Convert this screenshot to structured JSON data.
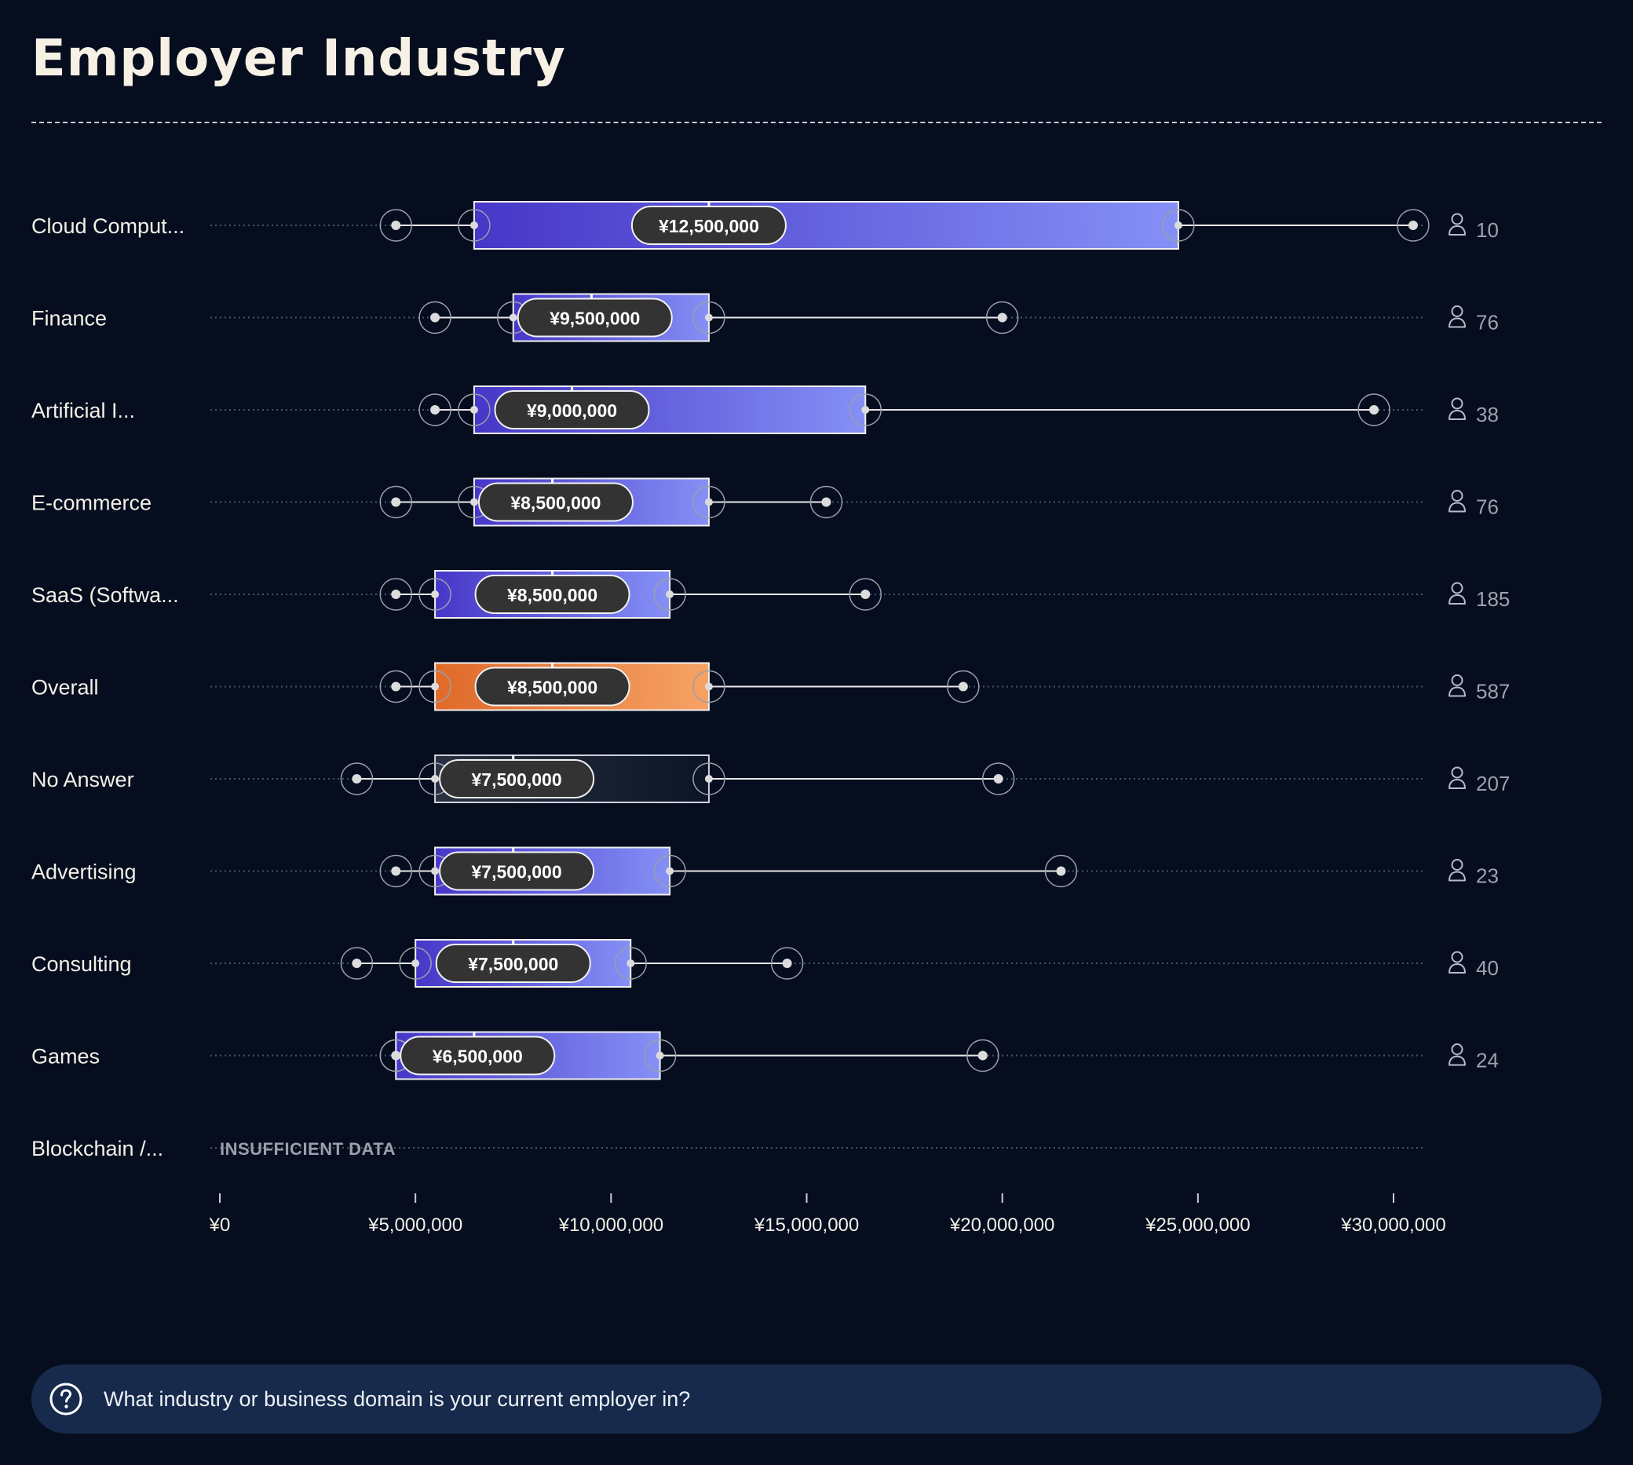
{
  "page": {
    "title": "Employer Industry",
    "question": "What industry or business domain is your current employer in?"
  },
  "icons": {
    "respondents": "person-icon",
    "question": "question-circle-icon"
  },
  "colors": {
    "background": "#050d1f",
    "box_default_start": "#4737c8",
    "box_default_end": "#8590f5",
    "box_overall_start": "#e06a2a",
    "box_overall_end": "#f6a265",
    "box_no_answer_start": "#2a3142",
    "box_no_answer_end": "#0b1526",
    "median_pill": "#333333",
    "footer_bg": "#172a4b"
  },
  "chart_data": {
    "type": "boxplot",
    "orientation": "horizontal",
    "title": "Employer Industry",
    "xlim": [
      0,
      30000000
    ],
    "x_ticks": [
      0,
      5000000,
      10000000,
      15000000,
      20000000,
      25000000,
      30000000
    ],
    "x_tick_labels": [
      "¥0",
      "¥5,000,000",
      "¥10,000,000",
      "¥15,000,000",
      "¥20,000,000",
      "¥25,000,000",
      "¥30,000,000"
    ],
    "insufficient_label": "INSUFFICIENT DATA",
    "categories": [
      {
        "label": "Cloud Comput...",
        "min": 4500000,
        "q1": 6500000,
        "median": 12500000,
        "q3": 24500000,
        "max": 30500000,
        "median_label": "¥12,500,000",
        "count": "10",
        "style": "default"
      },
      {
        "label": "Finance",
        "min": 5500000,
        "q1": 7500000,
        "median": 9500000,
        "q3": 12500000,
        "max": 20000000,
        "median_label": "¥9,500,000",
        "count": "76",
        "style": "default"
      },
      {
        "label": "Artificial I...",
        "min": 5500000,
        "q1": 6500000,
        "median": 9000000,
        "q3": 16500000,
        "max": 29500000,
        "median_label": "¥9,000,000",
        "count": "38",
        "style": "default"
      },
      {
        "label": "E-commerce",
        "min": 4500000,
        "q1": 6500000,
        "median": 8500000,
        "q3": 12500000,
        "max": 15500000,
        "median_label": "¥8,500,000",
        "count": "76",
        "style": "default"
      },
      {
        "label": "SaaS (Softwa...",
        "min": 4500000,
        "q1": 5500000,
        "median": 8500000,
        "q3": 11500000,
        "max": 16500000,
        "median_label": "¥8,500,000",
        "count": "185",
        "style": "default"
      },
      {
        "label": "Overall",
        "min": 4500000,
        "q1": 5500000,
        "median": 8500000,
        "q3": 12500000,
        "max": 19000000,
        "median_label": "¥8,500,000",
        "count": "587",
        "style": "overall"
      },
      {
        "label": "No Answer",
        "min": 3500000,
        "q1": 5500000,
        "median": 7500000,
        "q3": 12500000,
        "max": 19900000,
        "median_label": "¥7,500,000",
        "count": "207",
        "style": "no_answer"
      },
      {
        "label": "Advertising",
        "min": 4500000,
        "q1": 5500000,
        "median": 7500000,
        "q3": 11500000,
        "max": 21500000,
        "median_label": "¥7,500,000",
        "count": "23",
        "style": "default"
      },
      {
        "label": "Consulting",
        "min": 3500000,
        "q1": 5000000,
        "median": 7500000,
        "q3": 10500000,
        "max": 14500000,
        "median_label": "¥7,500,000",
        "count": "40",
        "style": "default"
      },
      {
        "label": "Games",
        "min": 4500000,
        "q1": 4500000,
        "median": 6500000,
        "q3": 11250000,
        "max": 19500000,
        "median_label": "¥6,500,000",
        "count": "24",
        "style": "default"
      },
      {
        "label": "Blockchain /...",
        "insufficient": true
      }
    ]
  }
}
